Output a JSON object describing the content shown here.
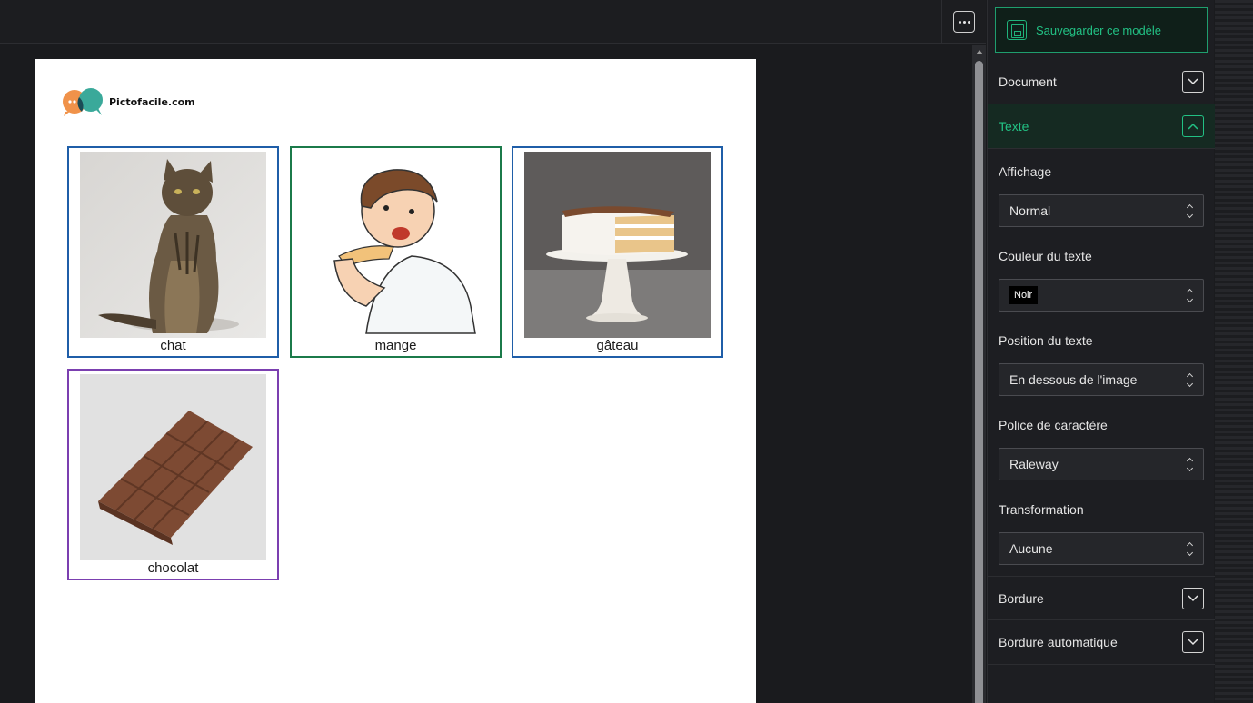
{
  "toolbar": {
    "more_icon": "ellipsis-icon"
  },
  "page": {
    "logo_text": "Pictofacile.com",
    "cards": [
      {
        "label": "chat",
        "border": "#1f5ea8",
        "image": "cat-photo"
      },
      {
        "label": "mange",
        "border": "#1b7a4a",
        "image": "boy-eating-drawing"
      },
      {
        "label": "gâteau",
        "border": "#1f5ea8",
        "image": "cake-photo"
      },
      {
        "label": "chocolat",
        "border": "#7b3fb0",
        "image": "chocolate-bar-photo"
      }
    ]
  },
  "panel": {
    "save_label": "Sauvegarder ce modèle",
    "sections": {
      "document": "Document",
      "texte": "Texte",
      "bordure": "Bordure",
      "bordure_auto": "Bordure automatique"
    },
    "fields": {
      "affichage": {
        "label": "Affichage",
        "value": "Normal"
      },
      "couleur": {
        "label": "Couleur du texte",
        "value": "Noir"
      },
      "position": {
        "label": "Position du texte",
        "value": "En dessous de l'image"
      },
      "police": {
        "label": "Police de caractère",
        "value": "Raleway"
      },
      "transformation": {
        "label": "Transformation",
        "value": "Aucune"
      }
    }
  },
  "colors": {
    "accent": "#22c184",
    "panel_bg": "#1d1e22"
  }
}
